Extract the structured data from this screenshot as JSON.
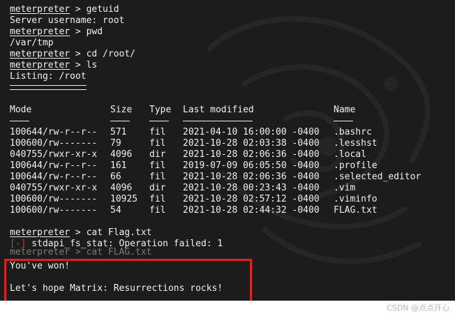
{
  "terminal": {
    "prompt": "meterpreter",
    "cmd_getuid": " > getuid",
    "server_user": "Server username: root",
    "cmd_pwd": " > pwd",
    "pwd_out": "/var/tmp",
    "cmd_cd": " > cd /root/",
    "cmd_ls": " > ls",
    "listing": "Listing: /root",
    "headers": {
      "mode": "Mode",
      "size": "Size",
      "type": "Type",
      "modified": "Last modified",
      "name": "Name"
    },
    "rows": [
      {
        "mode": "100644/rw-r--r--",
        "size": "571",
        "type": "fil",
        "modified": "2021-04-10 16:00:00 -0400",
        "name": ".bashrc"
      },
      {
        "mode": "100600/rw-------",
        "size": "79",
        "type": "fil",
        "modified": "2021-10-28 02:03:38 -0400",
        "name": ".lesshst"
      },
      {
        "mode": "040755/rwxr-xr-x",
        "size": "4096",
        "type": "dir",
        "modified": "2021-10-28 02:06:36 -0400",
        "name": ".local"
      },
      {
        "mode": "100644/rw-r--r--",
        "size": "161",
        "type": "fil",
        "modified": "2019-07-09 06:05:50 -0400",
        "name": ".profile"
      },
      {
        "mode": "100644/rw-r--r--",
        "size": "66",
        "type": "fil",
        "modified": "2021-10-28 02:06:36 -0400",
        "name": ".selected_editor"
      },
      {
        "mode": "040755/rwxr-xr-x",
        "size": "4096",
        "type": "dir",
        "modified": "2021-10-28 00:23:43 -0400",
        "name": ".vim"
      },
      {
        "mode": "100600/rw-------",
        "size": "10925",
        "type": "fil",
        "modified": "2021-10-28 02:57:12 -0400",
        "name": ".viminfo"
      },
      {
        "mode": "100600/rw-------",
        "size": "54",
        "type": "fil",
        "modified": "2021-10-28 02:44:32 -0400",
        "name": "FLAG.txt"
      }
    ],
    "cmd_cat1": " > cat Flag.txt",
    "err_mark": "[-]",
    "err_text": " stdapi_fs_stat: Operation failed: 1",
    "cmd_cat2": "meterpreter > cat FLAG.txt",
    "won": "You've won!",
    "hope": "Let's hope Matrix: Resurrections rocks!"
  },
  "watermark": "CSDN @点点开心",
  "colors": {
    "background": "#1c1c1c",
    "text": "#f0f0f0",
    "error": "#d93030",
    "highlight_box": "#e02020"
  }
}
